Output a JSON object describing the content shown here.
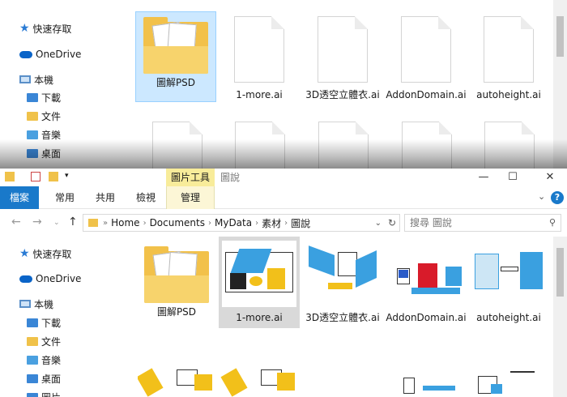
{
  "sidebar": {
    "quick_access": "快速存取",
    "onedrive": "OneDrive",
    "this_pc": "本機",
    "downloads": "下載",
    "documents": "文件",
    "music": "音樂",
    "desktop": "桌面",
    "pictures": "圖片"
  },
  "top_files": [
    {
      "name": "圖解PSD",
      "kind": "folder"
    },
    {
      "name": "1-more.ai",
      "kind": "file"
    },
    {
      "name": "3D透空立體衣.ai",
      "kind": "file"
    },
    {
      "name": "AddonDomain.ai",
      "kind": "file"
    },
    {
      "name": "autoheight.ai",
      "kind": "file"
    }
  ],
  "ribbon": {
    "context_group": "圖片工具",
    "window_title": "圖說",
    "file_tab": "檔案",
    "tabs": [
      "常用",
      "共用",
      "檢視",
      "管理"
    ],
    "help": "?"
  },
  "address": {
    "crumbs": [
      "Home",
      "Documents",
      "MyData",
      "素材",
      "圖說"
    ],
    "search_placeholder": "搜尋 圖說"
  },
  "bottom_files": [
    {
      "name": "圖解PSD",
      "kind": "folder"
    },
    {
      "name": "1-more.ai",
      "kind": "image"
    },
    {
      "name": "3D透空立體衣.ai",
      "kind": "image"
    },
    {
      "name": "AddonDomain.ai",
      "kind": "image"
    },
    {
      "name": "autoheight.ai",
      "kind": "image"
    }
  ],
  "colors": {
    "accent": "#1979ca",
    "context_tab": "#f8ec9a",
    "selection": "#cce8ff"
  }
}
